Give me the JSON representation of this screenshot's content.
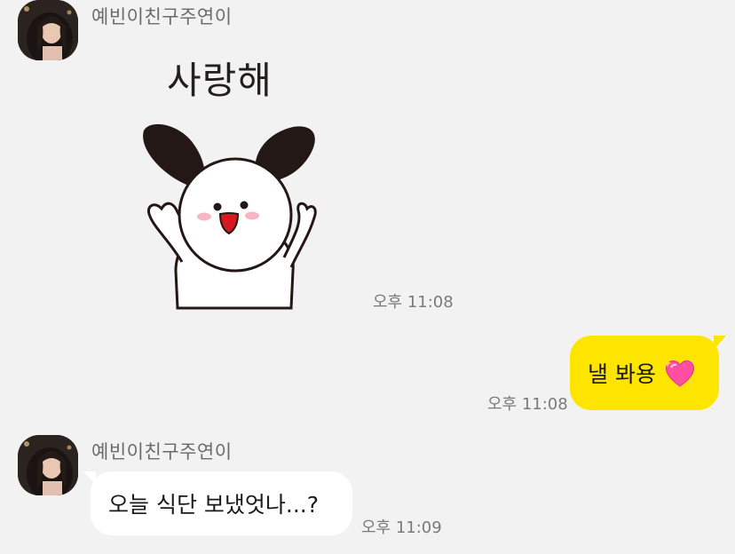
{
  "chat": {
    "messages": [
      {
        "sender": "예빈이친구주연이",
        "type": "sticker",
        "sticker_text": "사랑해",
        "time": "오후 11:08"
      },
      {
        "direction": "outgoing",
        "text": "낼 봐용",
        "emoji": "sparkling-heart",
        "time": "오후 11:08"
      },
      {
        "sender": "예빈이친구주연이",
        "text": "오늘 식단 보냈엇나...?",
        "time": "오후 11:09"
      }
    ]
  },
  "colors": {
    "background": "#f2f2f2",
    "outgoing_bubble": "#fee500",
    "incoming_bubble": "#ffffff",
    "heart": "#ff4fa3"
  }
}
